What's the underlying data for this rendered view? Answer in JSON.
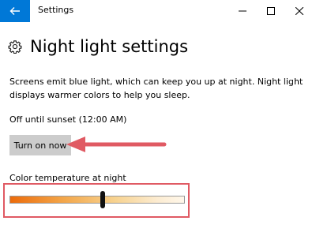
{
  "window": {
    "title": "Settings",
    "accent": "#0078d7"
  },
  "icons": {
    "back": "back-arrow-icon",
    "minimize": "minimize-icon",
    "maximize": "maximize-icon",
    "close": "close-icon",
    "settings": "gear-icon"
  },
  "page": {
    "title": "Night light settings",
    "description": "Screens emit blue light, which can keep you up at night. Night light displays warmer colors to help you sleep.",
    "status": "Off until sunset (12:00 AM)",
    "turn_on_label": "Turn on now",
    "color_temp_label": "Color temperature at night",
    "color_temp_level": 0.53
  },
  "annotations": {
    "color": "#e05a63"
  }
}
